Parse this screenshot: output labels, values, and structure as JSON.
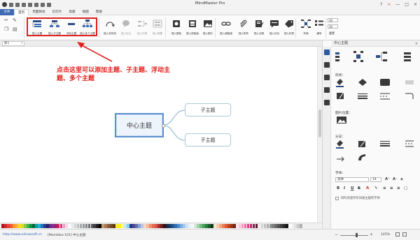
{
  "window": {
    "title": "MindMaster Pro",
    "controls": [
      "?",
      "<",
      "—",
      "□",
      "×"
    ]
  },
  "menu": {
    "tabs": [
      "文件",
      "首页",
      "页面样式",
      "幻灯片",
      "高级",
      "视图",
      "帮助"
    ],
    "active_index": 1
  },
  "ribbon": {
    "insert_topic": "插入主题",
    "insert_subtopic": "插入子主题",
    "floating_topic": "浮动主题",
    "multiple_topics": "插入多个主题",
    "relationship": "插入关系线",
    "callout": "插入标注",
    "summary": "插入外框",
    "boundary": "插入概要",
    "icon": "插入图标",
    "clipart": "插入剪贴画",
    "image": "插入图片",
    "hyperlink": "插入超链接",
    "attachment": "插入附件",
    "note": "插入注释",
    "comment": "插入评论",
    "tag": "插入标签",
    "layout": "布局",
    "numbering": "编号",
    "spacing_1": "30",
    "spacing_2": "30",
    "reset": "重置"
  },
  "document": {
    "tab_label": "新1"
  },
  "canvas": {
    "annotation_line1": "点击这里可以添加主题、子主题、浮动主",
    "annotation_line2": "题、多个主题",
    "central_topic": "中心主题",
    "subtopics": [
      "子主题",
      "子主题"
    ]
  },
  "panel": {
    "title": "中心主题",
    "shape_label": "形状：",
    "image_position_label": "图片位置：",
    "branch_label": "分支：",
    "font_label": "字体：",
    "font_family": "宋体",
    "font_size": "14",
    "format_buttons": [
      "B",
      "I",
      "U",
      "S",
      "A"
    ],
    "apply_same_level": "同时改变所有同级主题的字体"
  },
  "palette": {
    "colors": [
      "#b31217",
      "#d6262b",
      "#e6413a",
      "#f15a29",
      "#f7941d",
      "#fbb040",
      "#ffde17",
      "#d7df23",
      "#8dc63f",
      "#39b54a",
      "#009444",
      "#006838",
      "#00a79d",
      "#27aae1",
      "#1c75bc",
      "#2b3990",
      "#262262",
      "#662d91",
      "#92278f",
      "#9e1f63",
      "#da1c5c",
      "#ee2a7b",
      "#f49ac1",
      "#fbd3e9",
      "#ffffff",
      "#e6e7e8",
      "#d1d3d4",
      "#bcbec0",
      "#a7a9ac",
      "#939598",
      "#808285",
      "#6d6e71",
      "#58595b",
      "#414042",
      "#231f20",
      "#000000",
      "#c49a6c",
      "#a97c50",
      "#8b5e3c",
      "#754c29",
      "#603913",
      "#f9ed32",
      "#fff200",
      "#fff799",
      "#c2e7f6",
      "#7dd3f7",
      "#2e3192",
      "#4a4a8c",
      "#5e6fb5",
      "#8ea0d3",
      "#b9c4e4",
      "#f8d7c2",
      "#f6b69b",
      "#f08d6c",
      "#e56b4f",
      "#d9534f",
      "#aa2f2f",
      "#6b1d1d",
      "#3b0c0c",
      "#0f2d52",
      "#173f6e",
      "#21558f",
      "#2e6eb3",
      "#4a8bd1",
      "#79acdf",
      "#a6c8ec",
      "#d2e3f6",
      "#e8f1fa",
      "#f4f8fc",
      "#cfe8d4",
      "#a1d1ad",
      "#6fb982",
      "#449d5b",
      "#2a7d40",
      "#1b5c2c",
      "#0f3d1c",
      "#fce4d6",
      "#f9c9ad",
      "#f4a582",
      "#ec7f57",
      "#e05a33",
      "#c2411f",
      "#9c3215",
      "#76260f",
      "#ffe6f0",
      "#ffc2da",
      "#ff94bd",
      "#ff66a1",
      "#e63c85",
      "#b82e69",
      "#8a224e",
      "#5c1734",
      "#eaeaea",
      "#d5d5d5",
      "#bfbfbf",
      "#aaaaaa",
      "#949494",
      "#7f7f7f",
      "#696969",
      "#545454",
      "#3f3f3f",
      "#2a2a2a",
      "#151515",
      "#ffffff",
      "#f2f2f2",
      "#e0e0e0",
      "#c8c8c8",
      "#b0b0b0"
    ]
  },
  "statusbar": {
    "link": "http://www.edrawsoft.cn",
    "info": "[MainIdea 101]  中心主题",
    "zoom_percent": "145%"
  }
}
